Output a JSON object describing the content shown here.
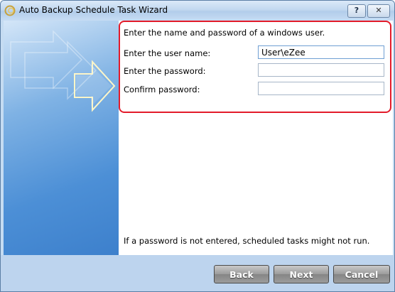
{
  "window": {
    "title": "Auto Backup Schedule Task Wizard",
    "help_label": "?",
    "close_label": "✕"
  },
  "form": {
    "intro": "Enter the name and password of a windows user.",
    "username_label": "Enter the user name:",
    "username_value": "User\\eZee",
    "password_label": "Enter the password:",
    "password_value": "",
    "confirm_label": "Confirm password:",
    "confirm_value": "",
    "note": "If a password is not entered, scheduled tasks might not run."
  },
  "buttons": {
    "back": "Back",
    "next": "Next",
    "cancel": "Cancel"
  },
  "colors": {
    "highlight": "#e31b2a",
    "side_panel": "#4c8fd6",
    "button": "#9b9b9b"
  }
}
